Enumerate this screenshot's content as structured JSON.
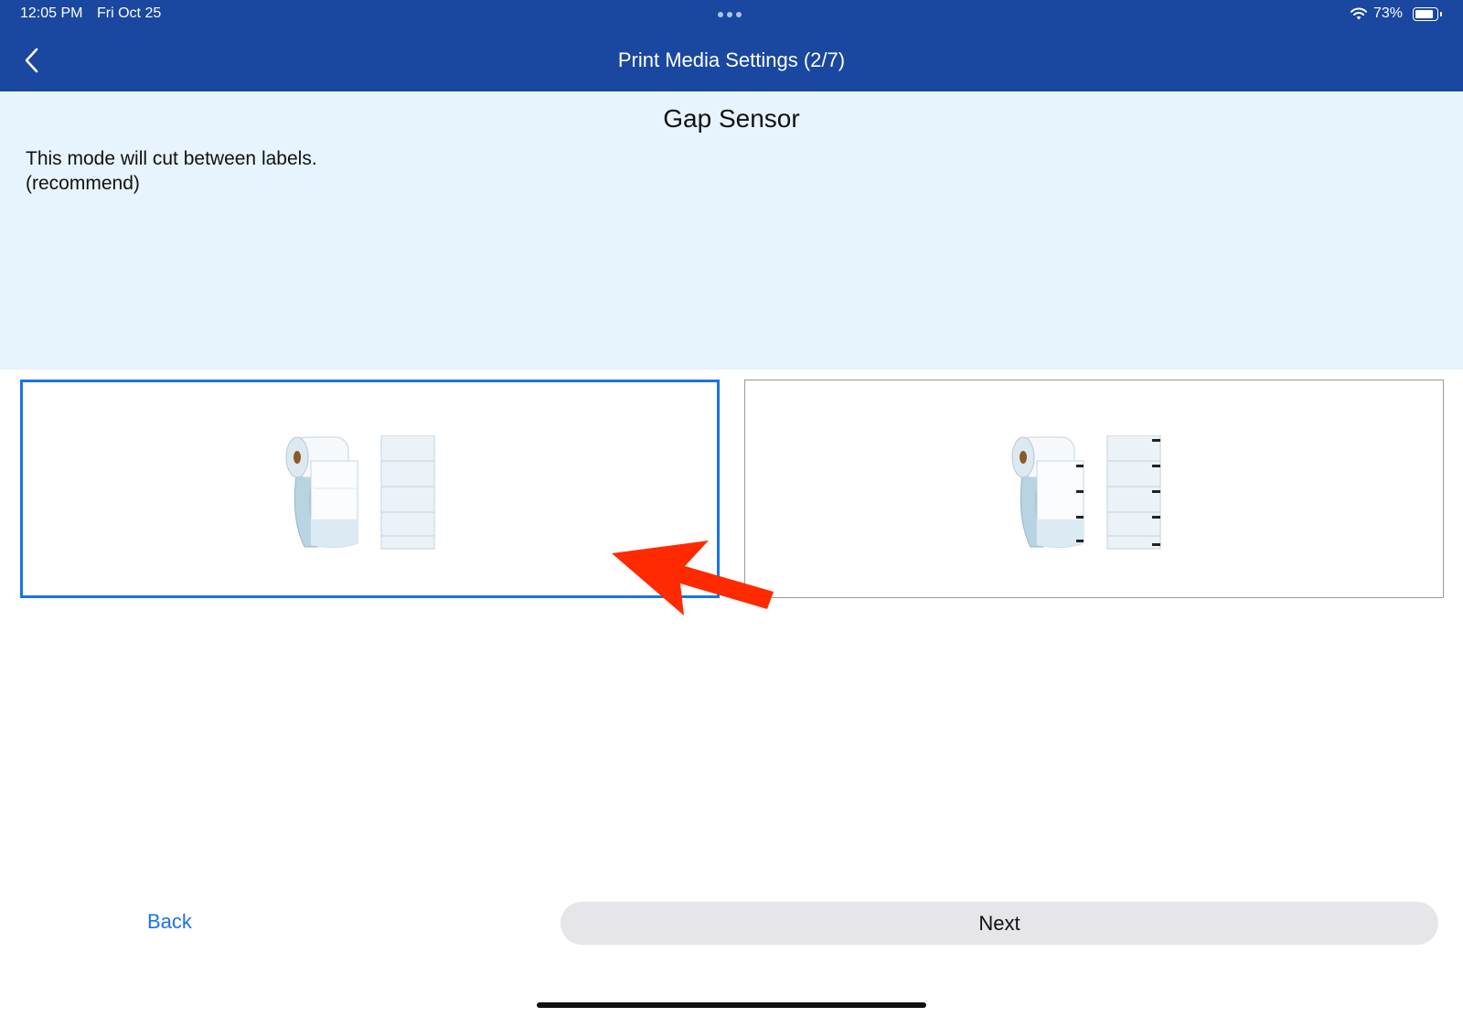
{
  "status_bar": {
    "time": "12:05 PM",
    "date": "Fri Oct 25",
    "battery_percent": "73%",
    "icons": [
      "wifi-icon",
      "battery-icon"
    ]
  },
  "nav": {
    "title": "Print Media Settings (2/7)",
    "back_icon": "chevron-left-icon"
  },
  "info": {
    "title": "Gap Sensor",
    "line1": "This mode will cut between labels.",
    "line2": "(recommend)"
  },
  "options": [
    {
      "id": "gap-sensor",
      "selected": true
    },
    {
      "id": "black-mark-sensor",
      "selected": false
    }
  ],
  "footer": {
    "back_label": "Back",
    "next_label": "Next"
  },
  "colors": {
    "nav_bg": "#1a47a0",
    "info_bg": "#e7f4fd",
    "accent": "#1a73e8",
    "annotation_arrow": "#ff2a00"
  }
}
